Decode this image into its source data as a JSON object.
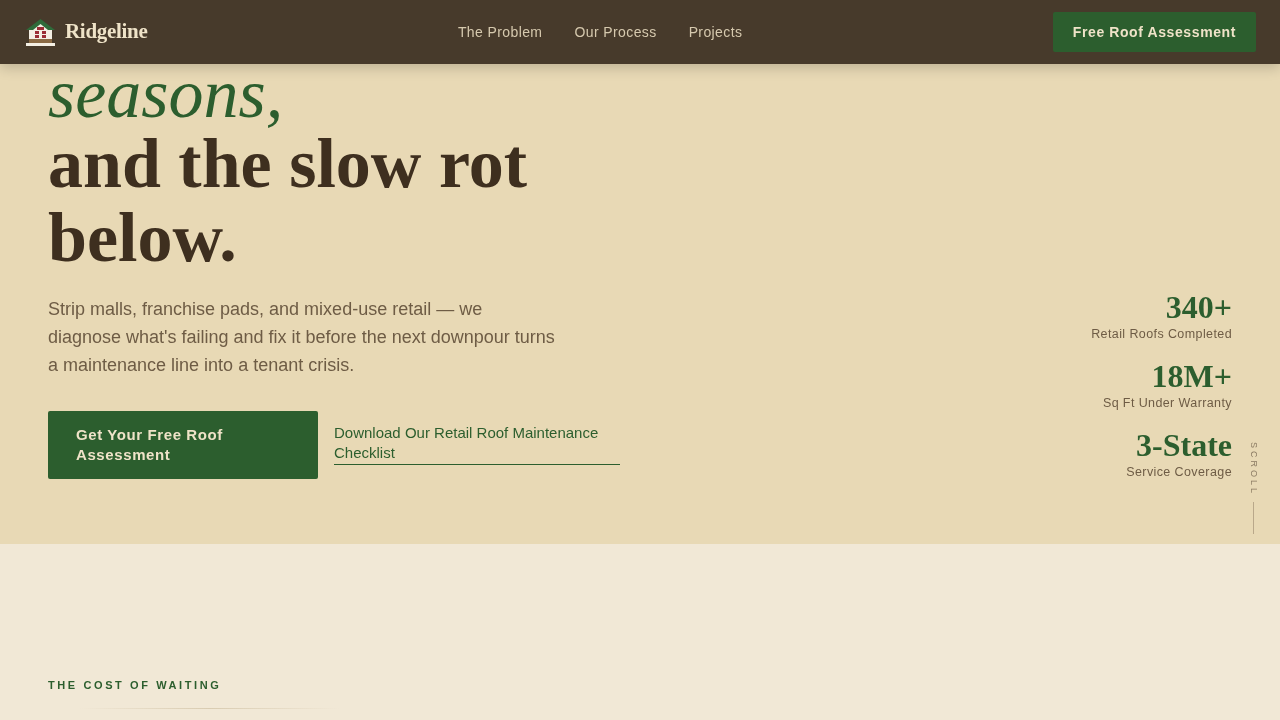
{
  "nav": {
    "brand": "Ridgeline",
    "links": [
      {
        "label": "The Problem"
      },
      {
        "label": "Our Process"
      },
      {
        "label": "Projects"
      }
    ],
    "cta": "Free Roof Assessment"
  },
  "hero": {
    "heading_lines": [
      {
        "text": "seasons,",
        "kind": "accent"
      },
      {
        "text": "and the slow rot below.",
        "kind": "plain"
      }
    ],
    "description": "Strip malls, franchise pads, and mixed-use retail — we diagnose what's failing and fix it before the next downpour turns a maintenance line into a tenant crisis.",
    "primary_button": "Get Your Free Roof Assessment",
    "secondary_link": "Download Our Retail Roof Maintenance Checklist",
    "stats": [
      {
        "value": "340+",
        "label": "Retail Roofs Completed"
      },
      {
        "value": "18M+",
        "label": "Sq Ft Under Warranty"
      },
      {
        "value": "3-State",
        "label": "Service Coverage"
      }
    ],
    "scroll_hint": "SCROLL"
  },
  "cost_section": {
    "eyebrow": "THE COST OF WAITING"
  }
}
